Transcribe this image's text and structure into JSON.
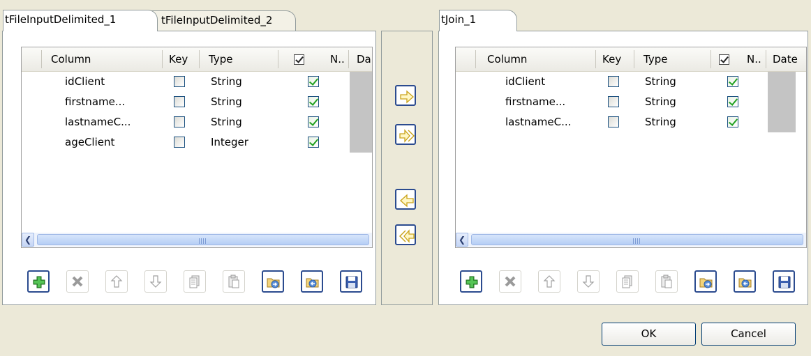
{
  "left": {
    "tabs": [
      {
        "label": "tFileInputDelimited_1"
      },
      {
        "label": "tFileInputDelimited_2"
      }
    ],
    "columns": {
      "column": "Column",
      "key": "Key",
      "type": "Type",
      "nullable": "N..",
      "date": "Da"
    },
    "rows": [
      {
        "name": "idClient",
        "key": false,
        "type": "String",
        "nullable": true
      },
      {
        "name": "firstname...",
        "key": false,
        "type": "String",
        "nullable": true
      },
      {
        "name": "lastnameC...",
        "key": false,
        "type": "String",
        "nullable": true
      },
      {
        "name": "ageClient",
        "key": false,
        "type": "Integer",
        "nullable": true
      }
    ]
  },
  "right": {
    "tabs": [
      {
        "label": "tJoin_1"
      }
    ],
    "columns": {
      "column": "Column",
      "key": "Key",
      "type": "Type",
      "nullable": "N..",
      "date": "Date"
    },
    "rows": [
      {
        "name": "idClient",
        "key": false,
        "type": "String",
        "nullable": true
      },
      {
        "name": "firstname...",
        "key": false,
        "type": "String",
        "nullable": true
      },
      {
        "name": "lastnameC...",
        "key": false,
        "type": "String",
        "nullable": true
      }
    ]
  },
  "toolbar_icons": [
    "add-icon",
    "delete-icon",
    "move-up-icon",
    "move-down-icon",
    "copy-icon",
    "paste-icon",
    "import-icon",
    "export-icon",
    "save-icon"
  ],
  "transfer_icons": [
    "copy-selected-right-icon",
    "copy-all-right-icon",
    "copy-selected-left-icon",
    "copy-all-left-icon"
  ],
  "buttons": {
    "ok": "OK",
    "cancel": "Cancel"
  }
}
